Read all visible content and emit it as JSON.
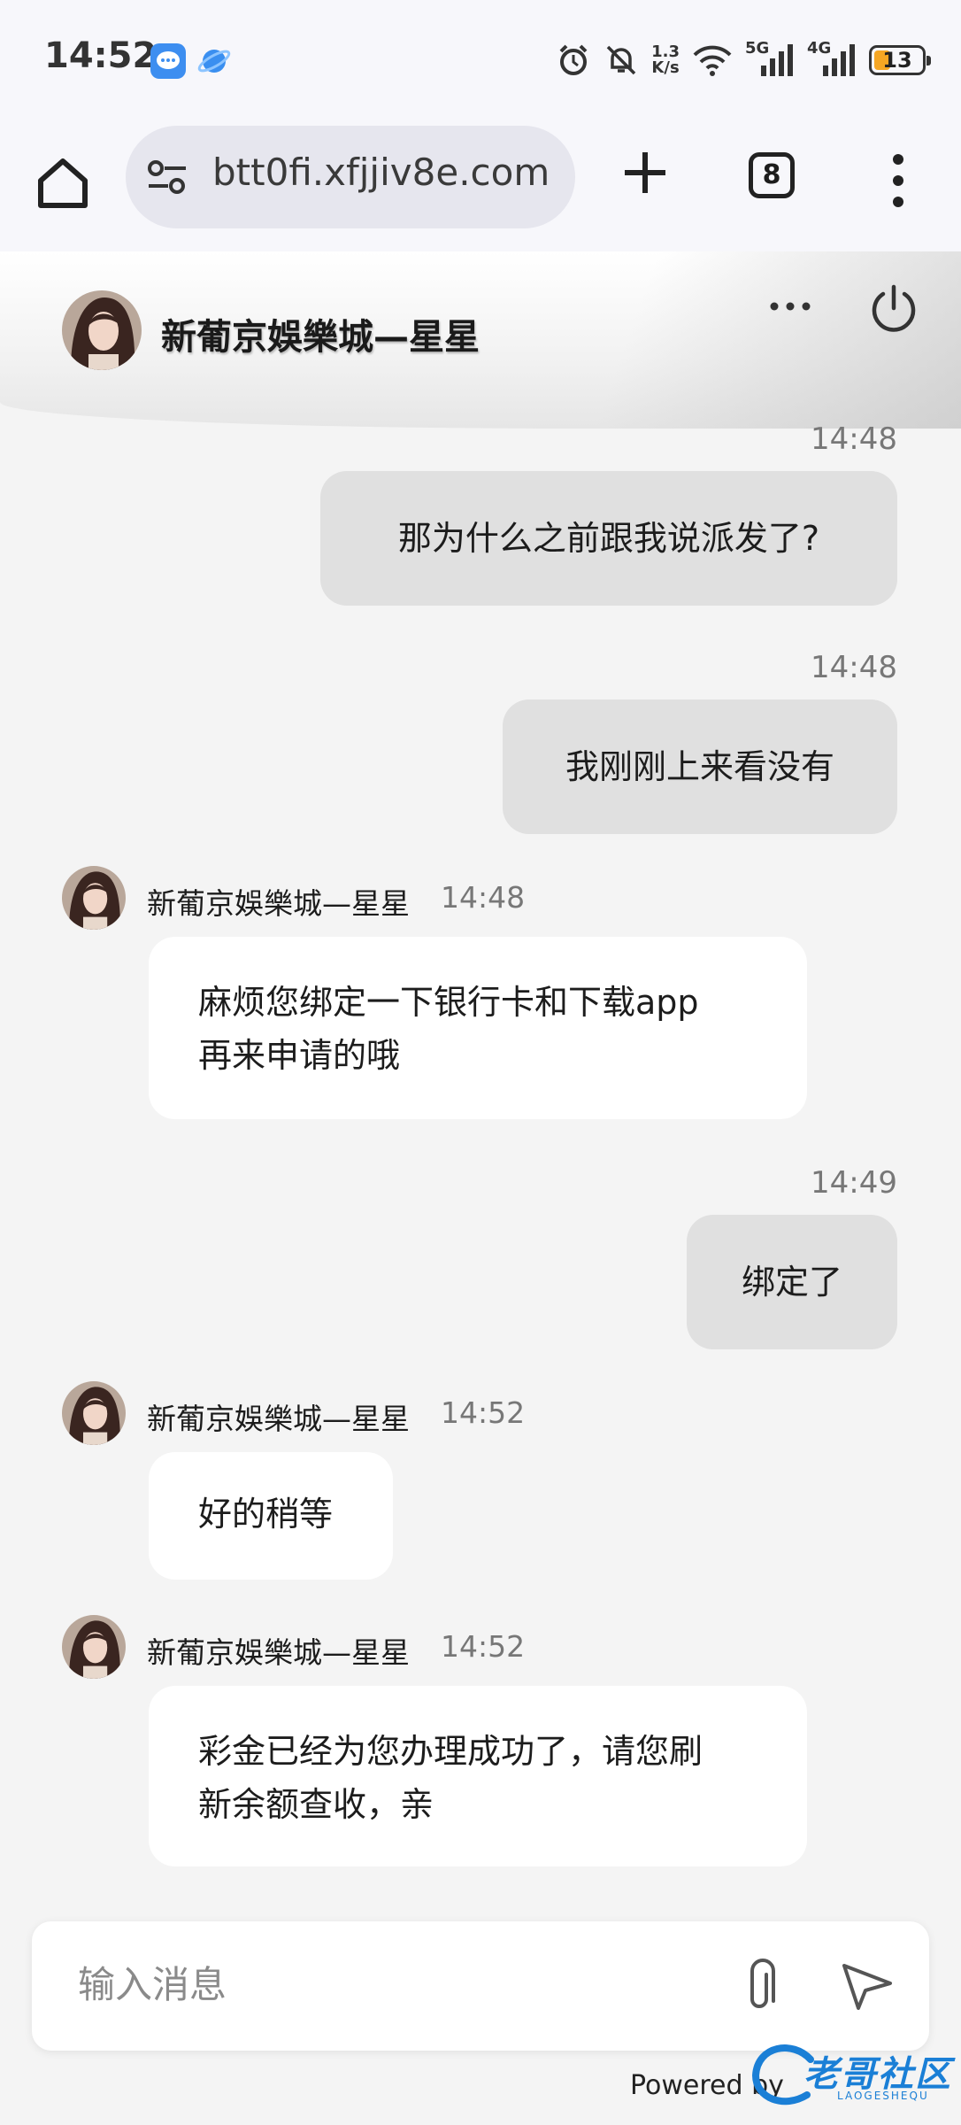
{
  "status_bar": {
    "time": "14:52",
    "net_speed_value": "1.3",
    "net_speed_unit": "K/s",
    "wifi_label": "5G",
    "cell_label": "4G",
    "battery": "13",
    "icons": [
      "message-app-icon",
      "browser-app-icon",
      "alarm-icon",
      "mute-icon",
      "wifi-icon",
      "signal-icon",
      "battery-icon"
    ]
  },
  "browser": {
    "url": "btt0fi.xfjjiv8e.com",
    "tab_count": "8"
  },
  "chat": {
    "title": "新葡京娛樂城—星星",
    "messages": [
      {
        "dir": "out",
        "time": "14:48",
        "text": "那为什么之前跟我说派发了?"
      },
      {
        "dir": "out",
        "time": "14:48",
        "text": "我刚刚上来看没有"
      },
      {
        "dir": "in",
        "sender": "新葡京娛樂城—星星",
        "time": "14:48",
        "line1": "麻烦您绑定一下银行卡和下载app",
        "line2": "再来申请的哦"
      },
      {
        "dir": "out",
        "time": "14:49",
        "text": "绑定了"
      },
      {
        "dir": "in",
        "sender": "新葡京娛樂城—星星",
        "time": "14:52",
        "text": "好的稍等"
      },
      {
        "dir": "in",
        "sender": "新葡京娛樂城—星星",
        "time": "14:52",
        "line1": "彩金已经为您办理成功了，请您刷",
        "line2": "新余额查收，亲"
      }
    ]
  },
  "composer": {
    "placeholder": "输入消息"
  },
  "footer": {
    "powered_by": "Powered by",
    "watermark": "老哥社区",
    "watermark_sub": "LAOGESHEQU"
  },
  "colors": {
    "page_bg": "#f4f4f4",
    "outgoing_bubble": "#e0e0e0",
    "incoming_bubble": "#ffffff",
    "battery_fill": "#f5a623",
    "watermark": "#1a7fd6"
  }
}
